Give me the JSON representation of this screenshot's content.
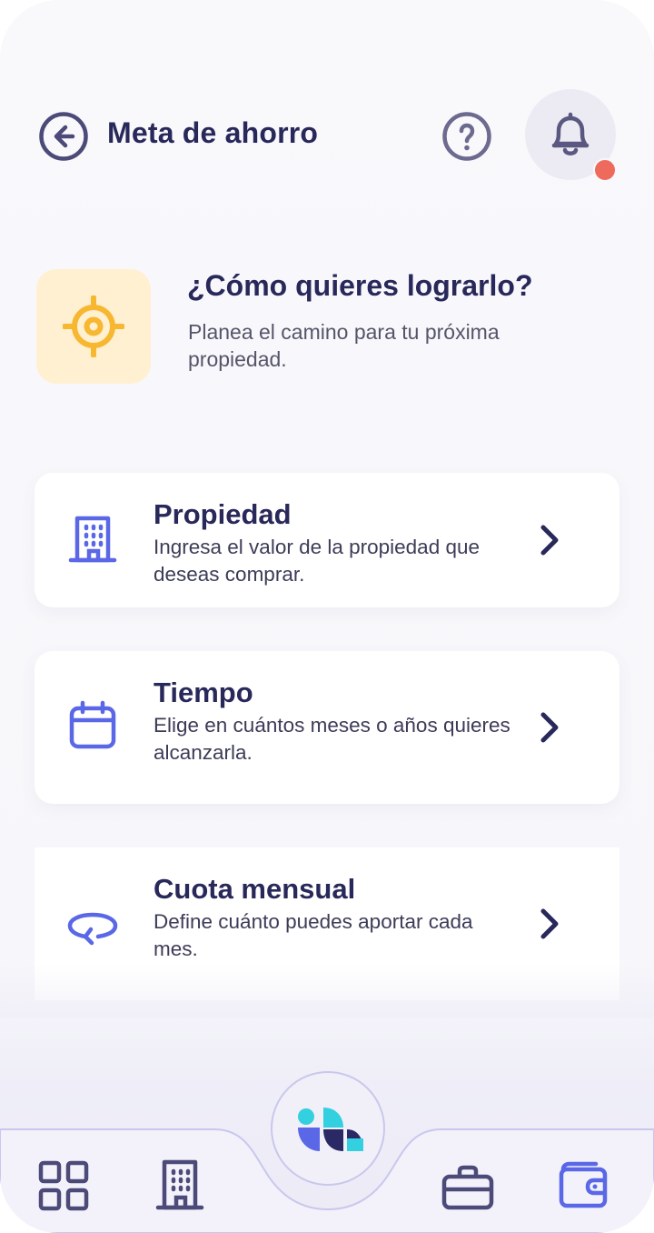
{
  "header": {
    "back_icon": "arrow-left-circle-icon",
    "title": "Meta de ahorro",
    "help_icon": "question-circle-icon",
    "notifications_icon": "bell-icon",
    "notification_dot_color": "#ee6a5c"
  },
  "intro": {
    "icon": "target-icon",
    "title": "¿Cómo quieres lograrlo?",
    "subtitle": "Planea el camino para tu próxima propiedad."
  },
  "options": [
    {
      "icon": "building-icon",
      "title": "Propiedad",
      "description": "Ingresa el valor de la propiedad que deseas comprar."
    },
    {
      "icon": "calendar-icon",
      "title": "Tiempo",
      "description": "Elige en cuántos meses o años quieres alcanzarla."
    },
    {
      "icon": "recurring-arrow-icon",
      "title": "Cuota mensual",
      "description": "Define cuánto puedes aportar cada mes."
    }
  ],
  "bottom_nav": {
    "items": [
      "grid-icon",
      "building-icon",
      "brand-logo-icon",
      "briefcase-icon",
      "wallet-icon"
    ],
    "active": "wallet-icon"
  },
  "colors": {
    "primary_text": "#28285a",
    "accent_blue": "#5a67e6",
    "goal_bg": "#fff0d1",
    "goal_icon": "#f7b731",
    "brand_cyan": "#33d0e0"
  }
}
